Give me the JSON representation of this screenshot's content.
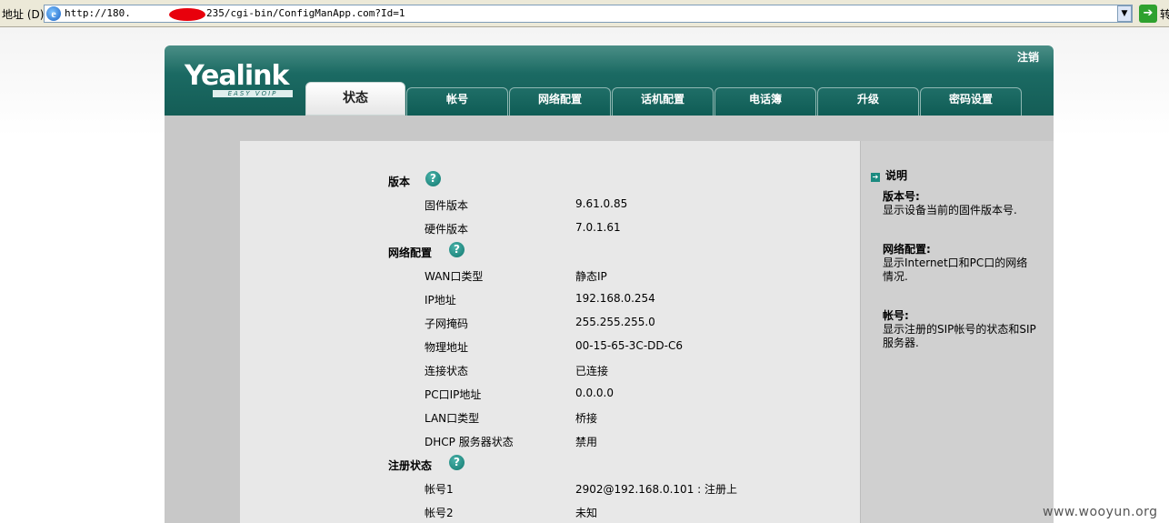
{
  "browser": {
    "address_label": "地址 (D)",
    "url_part1": "http://180.",
    "url_part2": "235/cgi-bin/ConfigManApp.com?Id=1",
    "go_label": "转"
  },
  "header": {
    "logo": "Yealink",
    "logo_sub": "EASY VOIP",
    "logout": "注销",
    "tabs": [
      {
        "label": "状态",
        "active": true
      },
      {
        "label": "帐号"
      },
      {
        "label": "网络配置"
      },
      {
        "label": "话机配置"
      },
      {
        "label": "电话簿"
      },
      {
        "label": "升级"
      },
      {
        "label": "密码设置"
      }
    ]
  },
  "status": {
    "version": {
      "title": "版本",
      "rows": [
        {
          "label": "固件版本",
          "value": "9.61.0.85"
        },
        {
          "label": "硬件版本",
          "value": "7.0.1.61"
        }
      ]
    },
    "network": {
      "title": "网络配置",
      "rows": [
        {
          "label": "WAN口类型",
          "value": "静态IP"
        },
        {
          "label": "IP地址",
          "value": "192.168.0.254"
        },
        {
          "label": "子网掩码",
          "value": "255.255.255.0"
        },
        {
          "label": "物理地址",
          "value": "00-15-65-3C-DD-C6"
        },
        {
          "label": "连接状态",
          "value": "已连接"
        },
        {
          "label": "PC口IP地址",
          "value": "0.0.0.0"
        },
        {
          "label": "LAN口类型",
          "value": "桥接"
        },
        {
          "label": "DHCP 服务器状态",
          "value": "禁用"
        }
      ]
    },
    "register": {
      "title": "注册状态",
      "rows": [
        {
          "label": "帐号1",
          "value": "2902@192.168.0.101 : 注册上"
        },
        {
          "label": "帐号2",
          "value": "未知"
        }
      ]
    }
  },
  "side": {
    "heading": "说明",
    "blocks": [
      {
        "title": "版本号:",
        "desc": "显示设备当前的固件版本号."
      },
      {
        "title": "网络配置:",
        "desc": "显示Internet口和PC口的网络情况."
      },
      {
        "title": "帐号:",
        "desc": "显示注册的SIP帐号的状态和SIP服务器."
      }
    ]
  },
  "watermark": "www.wooyun.org"
}
